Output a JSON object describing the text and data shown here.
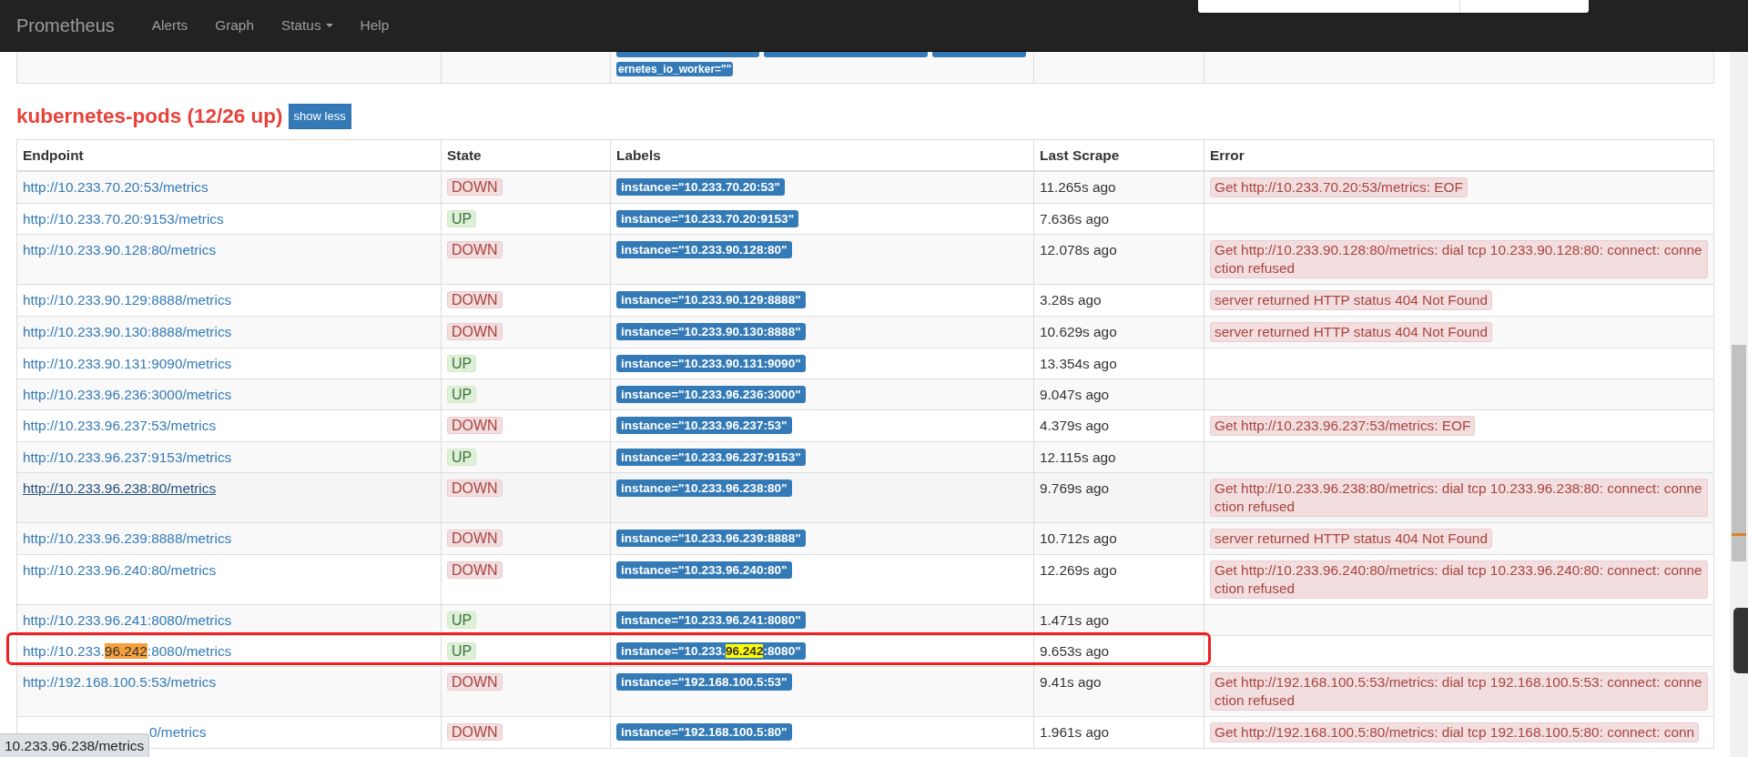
{
  "navbar": {
    "brand": "Prometheus",
    "items": [
      {
        "label": "Alerts",
        "dropdown": false
      },
      {
        "label": "Graph",
        "dropdown": false
      },
      {
        "label": "Status",
        "dropdown": true
      },
      {
        "label": "Help",
        "dropdown": false
      }
    ]
  },
  "previous_row": {
    "label": "ernetes_io_worker=\"\""
  },
  "section": {
    "title": "kubernetes-pods (12/26 up)",
    "toggle": "show less"
  },
  "table": {
    "columns": [
      "Endpoint",
      "State",
      "Labels",
      "Last Scrape",
      "Error"
    ],
    "rows": [
      {
        "endpoint": [
          {
            "text": "http://10.233.70.20:53/metrics",
            "highlighted": false
          }
        ],
        "state": "DOWN",
        "up": false,
        "labels": [
          {
            "text": "instance=\"10.233.70.20:53\"",
            "highlighted": false
          }
        ],
        "last_scrape": "11.265s ago",
        "error": "Get http://10.233.70.20:53/metrics: EOF",
        "hovered": false,
        "outlined": false,
        "covered": false
      },
      {
        "endpoint": [
          {
            "text": "http://10.233.70.20:9153/metrics",
            "highlighted": false
          }
        ],
        "state": "UP",
        "up": true,
        "labels": [
          {
            "text": "instance=\"10.233.70.20:9153\"",
            "highlighted": false
          }
        ],
        "last_scrape": "7.636s ago",
        "hovered": false,
        "outlined": false,
        "covered": false
      },
      {
        "endpoint": [
          {
            "text": "http://10.233.90.128:80/metrics",
            "highlighted": false
          }
        ],
        "state": "DOWN",
        "up": false,
        "labels": [
          {
            "text": "instance=\"10.233.90.128:80\"",
            "highlighted": false
          }
        ],
        "last_scrape": "12.078s ago",
        "error": "Get http://10.233.90.128:80/metrics: dial tcp 10.233.90.128:80: connect: connection refused",
        "hovered": false,
        "outlined": false,
        "covered": false
      },
      {
        "endpoint": [
          {
            "text": "http://10.233.90.129:8888/metrics",
            "highlighted": false
          }
        ],
        "state": "DOWN",
        "up": false,
        "labels": [
          {
            "text": "instance=\"10.233.90.129:8888\"",
            "highlighted": false
          }
        ],
        "last_scrape": "3.28s ago",
        "error": "server returned HTTP status 404 Not Found",
        "hovered": false,
        "outlined": false,
        "covered": false
      },
      {
        "endpoint": [
          {
            "text": "http://10.233.90.130:8888/metrics",
            "highlighted": false
          }
        ],
        "state": "DOWN",
        "up": false,
        "labels": [
          {
            "text": "instance=\"10.233.90.130:8888\"",
            "highlighted": false
          }
        ],
        "last_scrape": "10.629s ago",
        "error": "server returned HTTP status 404 Not Found",
        "hovered": false,
        "outlined": false,
        "covered": false
      },
      {
        "endpoint": [
          {
            "text": "http://10.233.90.131:9090/metrics",
            "highlighted": false
          }
        ],
        "state": "UP",
        "up": true,
        "labels": [
          {
            "text": "instance=\"10.233.90.131:9090\"",
            "highlighted": false
          }
        ],
        "last_scrape": "13.354s ago",
        "hovered": false,
        "outlined": false,
        "covered": false
      },
      {
        "endpoint": [
          {
            "text": "http://10.233.96.236:3000/metrics",
            "highlighted": false
          }
        ],
        "state": "UP",
        "up": true,
        "labels": [
          {
            "text": "instance=\"10.233.96.236:3000\"",
            "highlighted": false
          }
        ],
        "last_scrape": "9.047s ago",
        "hovered": false,
        "outlined": false,
        "covered": false
      },
      {
        "endpoint": [
          {
            "text": "http://10.233.96.237:53/metrics",
            "highlighted": false
          }
        ],
        "state": "DOWN",
        "up": false,
        "labels": [
          {
            "text": "instance=\"10.233.96.237:53\"",
            "highlighted": false
          }
        ],
        "last_scrape": "4.379s ago",
        "error": "Get http://10.233.96.237:53/metrics: EOF",
        "hovered": false,
        "outlined": false,
        "covered": false
      },
      {
        "endpoint": [
          {
            "text": "http://10.233.96.237:9153/metrics",
            "highlighted": false
          }
        ],
        "state": "UP",
        "up": true,
        "labels": [
          {
            "text": "instance=\"10.233.96.237:9153\"",
            "highlighted": false
          }
        ],
        "last_scrape": "12.115s ago",
        "hovered": false,
        "outlined": false,
        "covered": false
      },
      {
        "endpoint": [
          {
            "text": "http://10.233.96.238:80/metrics",
            "highlighted": false
          }
        ],
        "state": "DOWN",
        "up": false,
        "labels": [
          {
            "text": "instance=\"10.233.96.238:80\"",
            "highlighted": false
          }
        ],
        "last_scrape": "9.769s ago",
        "error": "Get http://10.233.96.238:80/metrics: dial tcp 10.233.96.238:80: connect: connection refused",
        "hovered": true,
        "outlined": false,
        "covered": false
      },
      {
        "endpoint": [
          {
            "text": "http://10.233.96.239:8888/metrics",
            "highlighted": false
          }
        ],
        "state": "DOWN",
        "up": false,
        "labels": [
          {
            "text": "instance=\"10.233.96.239:8888\"",
            "highlighted": false
          }
        ],
        "last_scrape": "10.712s ago",
        "error": "server returned HTTP status 404 Not Found",
        "hovered": false,
        "outlined": false,
        "covered": false
      },
      {
        "endpoint": [
          {
            "text": "http://10.233.96.240:80/metrics",
            "highlighted": false
          }
        ],
        "state": "DOWN",
        "up": false,
        "labels": [
          {
            "text": "instance=\"10.233.96.240:80\"",
            "highlighted": false
          }
        ],
        "last_scrape": "12.269s ago",
        "error": "Get http://10.233.96.240:80/metrics: dial tcp 10.233.96.240:80: connect: connection refused",
        "hovered": false,
        "outlined": false,
        "covered": false
      },
      {
        "endpoint": [
          {
            "text": "http://10.233.96.241:8080/metrics",
            "highlighted": false
          }
        ],
        "state": "UP",
        "up": true,
        "labels": [
          {
            "text": "instance=\"10.233.96.241:8080\"",
            "highlighted": false
          }
        ],
        "last_scrape": "1.471s ago",
        "hovered": false,
        "outlined": false,
        "covered": false
      },
      {
        "endpoint": [
          {
            "text": "http://10.233.",
            "highlighted": false
          },
          {
            "text": "96.242",
            "highlighted": true
          },
          {
            "text": ":8080/metrics",
            "highlighted": false
          }
        ],
        "state": "UP",
        "up": true,
        "labels": [
          {
            "text": "instance=\"10.233.",
            "highlighted": false
          },
          {
            "text": "96.242",
            "highlighted": true
          },
          {
            "text": ":8080\"",
            "highlighted": false
          }
        ],
        "last_scrape": "9.653s ago",
        "hovered": false,
        "outlined": true,
        "covered": false
      },
      {
        "endpoint": [
          {
            "text": "http://192.168.100.5:53/metrics",
            "highlighted": false
          }
        ],
        "state": "DOWN",
        "up": false,
        "labels": [
          {
            "text": "instance=\"192.168.100.5:53\"",
            "highlighted": false
          }
        ],
        "last_scrape": "9.41s ago",
        "error": "Get http://192.168.100.5:53/metrics: dial tcp 192.168.100.5:53: connect: connection refused",
        "hovered": false,
        "outlined": false,
        "covered": false
      },
      {
        "endpoint": [
          {
            "text": "0/metrics",
            "highlighted": false
          }
        ],
        "state": "DOWN",
        "up": false,
        "labels": [
          {
            "text": "instance=\"192.168.100.5:80\"",
            "highlighted": false
          }
        ],
        "last_scrape": "1.961s ago",
        "error": "Get http://192.168.100.5:80/metrics: dial tcp 192.168.100.5:80: connect: conn",
        "hovered": false,
        "outlined": false,
        "covered": true
      }
    ]
  },
  "status_bar": "10.233.96.238/metrics"
}
